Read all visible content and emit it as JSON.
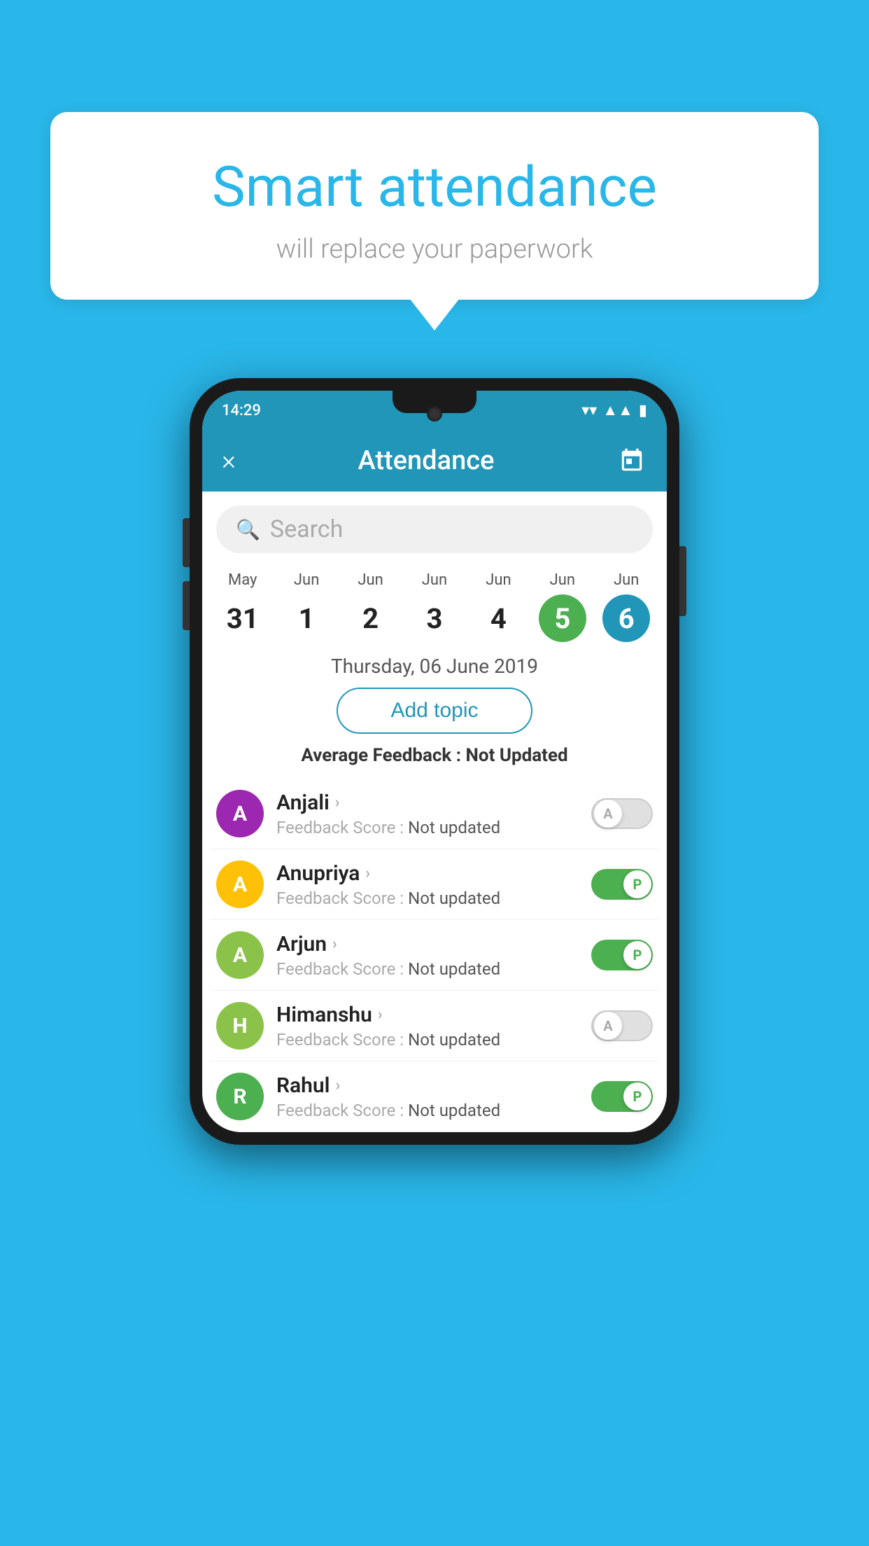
{
  "background_color": "#29b6e8",
  "speech_bubble": {
    "title": "Smart attendance",
    "subtitle": "will replace your paperwork"
  },
  "status_bar": {
    "time": "14:29",
    "icons": [
      "wifi",
      "signal",
      "battery"
    ]
  },
  "app_bar": {
    "title": "Attendance",
    "close_label": "×",
    "calendar_icon": "calendar"
  },
  "search": {
    "placeholder": "Search"
  },
  "calendar": {
    "days": [
      {
        "month": "May",
        "date": "31",
        "state": "normal"
      },
      {
        "month": "Jun",
        "date": "1",
        "state": "normal"
      },
      {
        "month": "Jun",
        "date": "2",
        "state": "normal"
      },
      {
        "month": "Jun",
        "date": "3",
        "state": "normal"
      },
      {
        "month": "Jun",
        "date": "4",
        "state": "normal"
      },
      {
        "month": "Jun",
        "date": "5",
        "state": "today"
      },
      {
        "month": "Jun",
        "date": "6",
        "state": "selected"
      }
    ],
    "selected_date_label": "Thursday, 06 June 2019"
  },
  "add_topic_button": "Add topic",
  "average_feedback": {
    "label": "Average Feedback :",
    "value": "Not Updated"
  },
  "students": [
    {
      "name": "Anjali",
      "avatar_letter": "A",
      "avatar_color": "#9c27b0",
      "feedback_label": "Feedback Score :",
      "feedback_value": "Not updated",
      "toggle_state": "off",
      "toggle_label": "A"
    },
    {
      "name": "Anupriya",
      "avatar_letter": "A",
      "avatar_color": "#ffc107",
      "feedback_label": "Feedback Score :",
      "feedback_value": "Not updated",
      "toggle_state": "on",
      "toggle_label": "P"
    },
    {
      "name": "Arjun",
      "avatar_letter": "A",
      "avatar_color": "#8bc34a",
      "feedback_label": "Feedback Score :",
      "feedback_value": "Not updated",
      "toggle_state": "on",
      "toggle_label": "P"
    },
    {
      "name": "Himanshu",
      "avatar_letter": "H",
      "avatar_color": "#8bc34a",
      "feedback_label": "Feedback Score :",
      "feedback_value": "Not updated",
      "toggle_state": "off",
      "toggle_label": "A"
    },
    {
      "name": "Rahul",
      "avatar_letter": "R",
      "avatar_color": "#4caf50",
      "feedback_label": "Feedback Score :",
      "feedback_value": "Not updated",
      "toggle_state": "on",
      "toggle_label": "P"
    }
  ]
}
